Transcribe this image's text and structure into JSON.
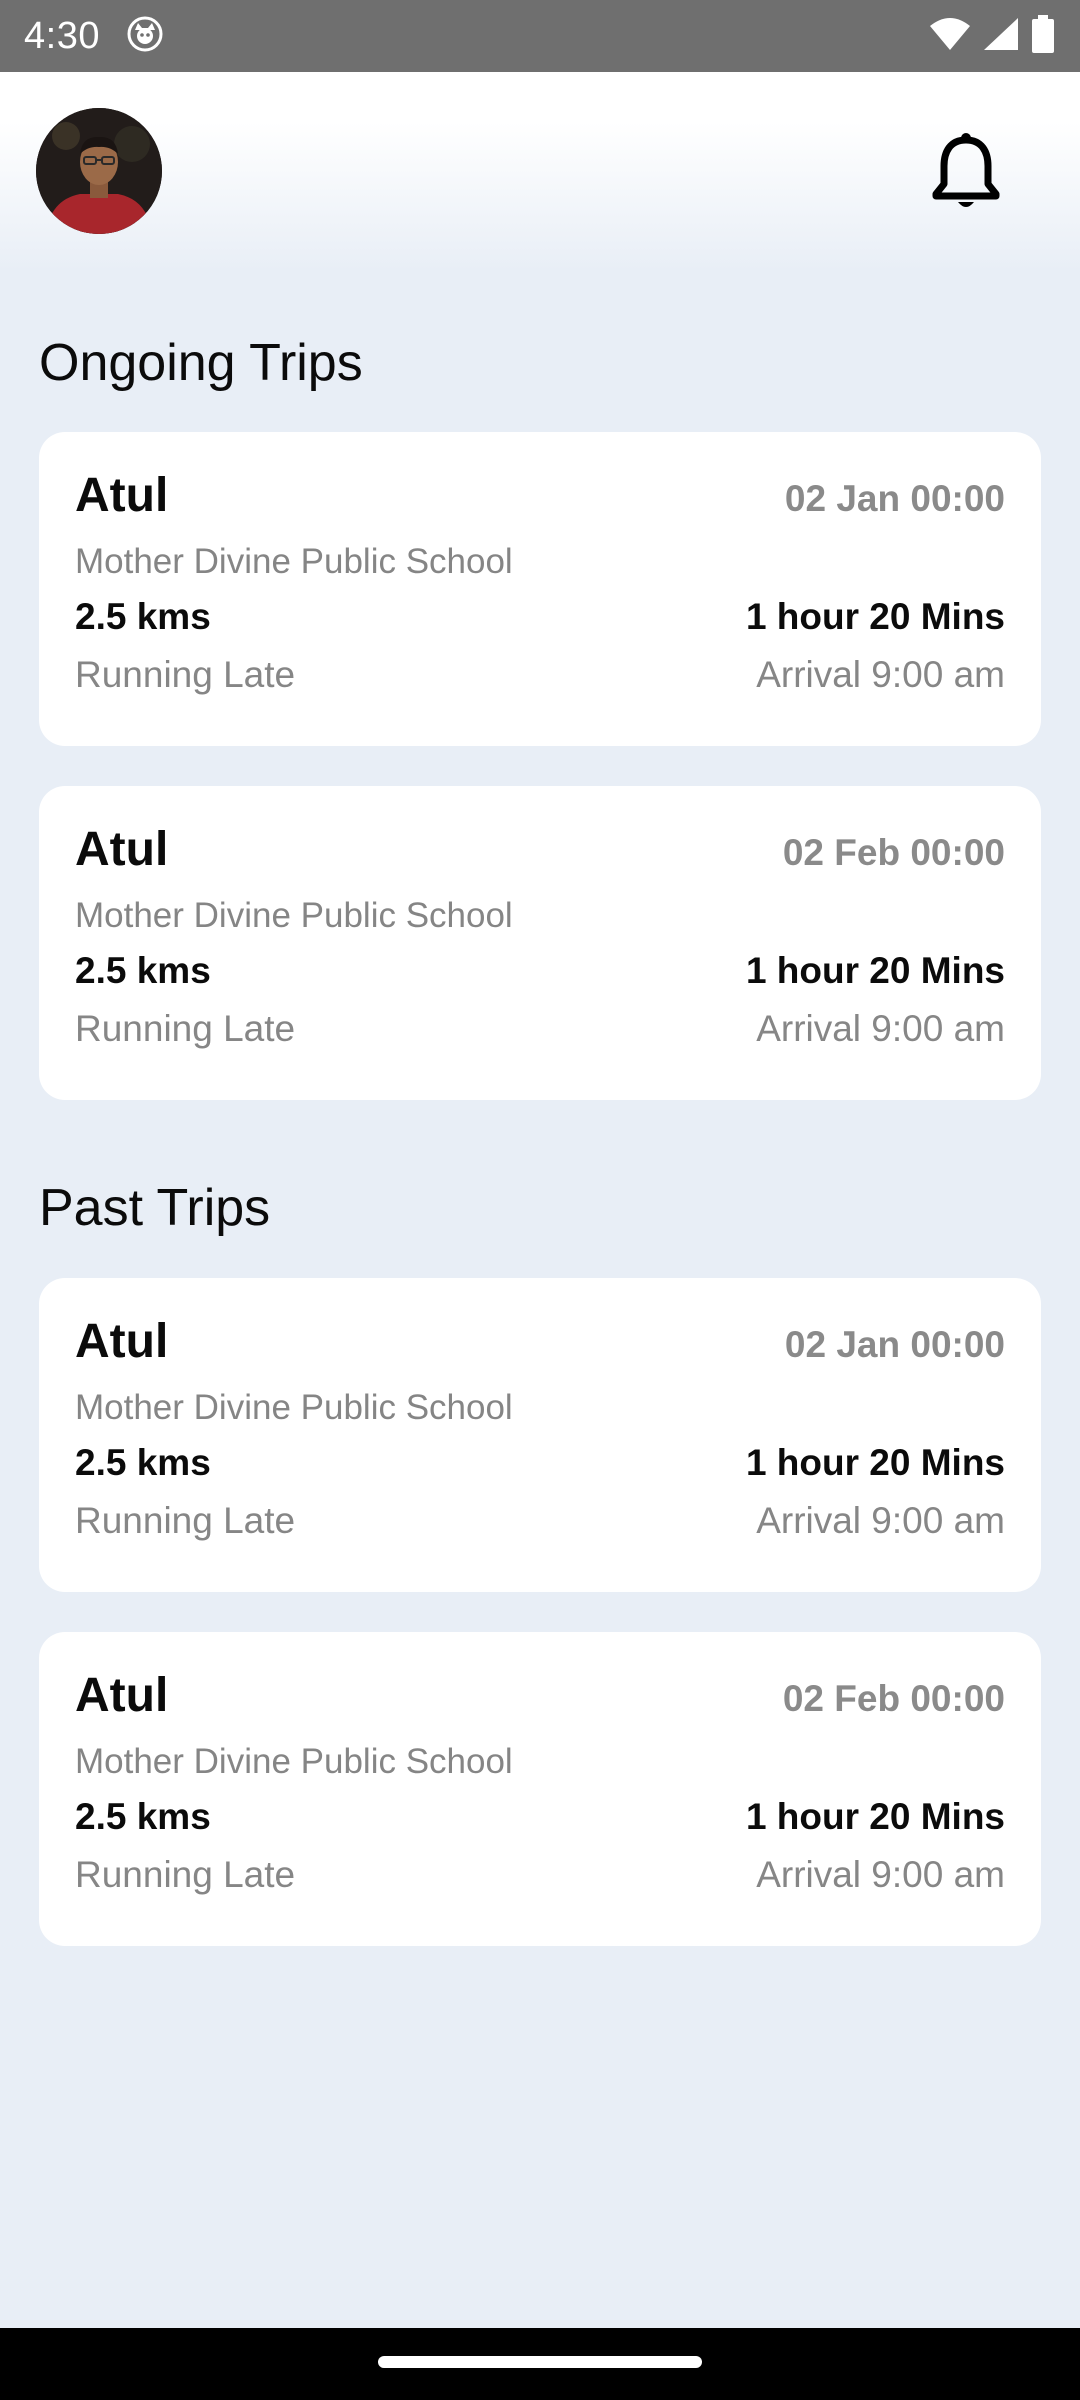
{
  "status_bar": {
    "time": "4:30",
    "icons": [
      "notification-app-icon",
      "wifi-icon",
      "cellular-signal-icon",
      "battery-icon"
    ]
  },
  "header": {
    "avatar": "profile-avatar",
    "notification_icon": "bell-icon"
  },
  "ongoing": {
    "title": "Ongoing Trips",
    "trips": [
      {
        "name": "Atul",
        "datetime": "02 Jan 00:00",
        "school": "Mother Divine Public School",
        "distance": "2.5 kms",
        "duration": "1 hour 20 Mins",
        "status": "Running Late",
        "arrival": "Arrival 9:00 am"
      },
      {
        "name": "Atul",
        "datetime": "02 Feb 00:00",
        "school": "Mother Divine Public School",
        "distance": "2.5 kms",
        "duration": "1 hour 20 Mins",
        "status": "Running Late",
        "arrival": "Arrival 9:00 am"
      }
    ]
  },
  "past": {
    "title": "Past Trips",
    "trips": [
      {
        "name": "Atul",
        "datetime": "02 Jan 00:00",
        "school": "Mother Divine Public School",
        "distance": "2.5 kms",
        "duration": "1 hour 20 Mins",
        "status": "Running Late",
        "arrival": "Arrival 9:00 am"
      },
      {
        "name": "Atul",
        "datetime": "02 Feb 00:00",
        "school": "Mother Divine Public School",
        "distance": "2.5 kms",
        "duration": "1 hour 20 Mins",
        "status": "Running Late",
        "arrival": "Arrival 9:00 am"
      }
    ]
  },
  "colors": {
    "background": "#e8eef6",
    "card": "#ffffff",
    "primary_text": "#0b0b0b",
    "secondary_text": "#868686",
    "status_bar": "#6f6f6f"
  }
}
